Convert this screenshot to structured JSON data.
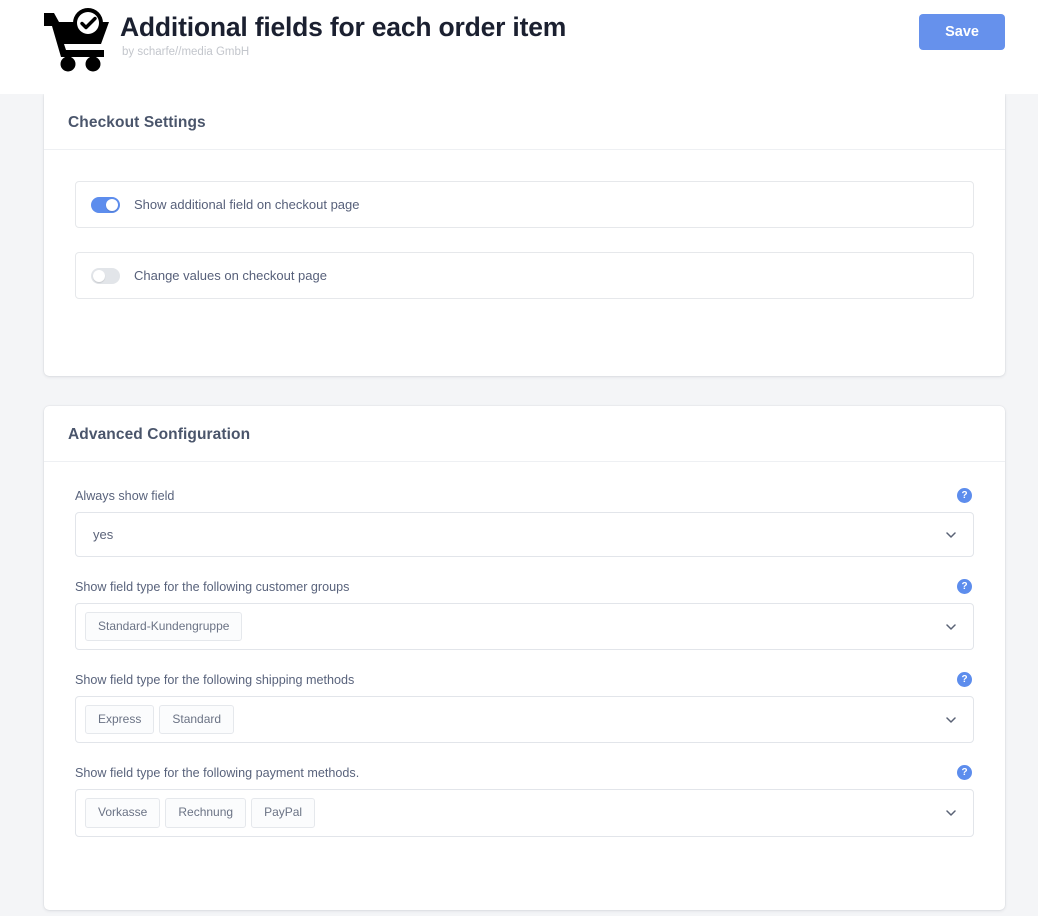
{
  "header": {
    "logo_icon": "shopping-cart-check-icon",
    "title": "Additional fields for each order item",
    "subtitle": "by scharfe//media GmbH",
    "save_label": "Save",
    "accent_color": "#6691ec"
  },
  "checkout_card": {
    "title": "Checkout Settings",
    "toggles": [
      {
        "label": "Show additional field on checkout page",
        "state": "on"
      },
      {
        "label": "Change values on checkout page",
        "state": "off"
      }
    ]
  },
  "advanced_card": {
    "title": "Advanced Configuration",
    "help_icon": "?",
    "fields": [
      {
        "label": "Always show field",
        "value": "yes",
        "tags": [],
        "chevron": "chevron-down-icon"
      },
      {
        "label": "Show field type for the following customer groups",
        "value": "",
        "tags": [
          "Standard-Kundengruppe"
        ],
        "chevron": "chevron-down-icon"
      },
      {
        "label": "Show field type for the following shipping methods",
        "value": "",
        "tags": [
          "Express",
          "Standard"
        ],
        "chevron": "chevron-down-icon"
      },
      {
        "label": "Show field type for the following payment methods.",
        "value": "",
        "tags": [
          "Vorkasse",
          "Rechnung",
          "PayPal"
        ],
        "chevron": "chevron-down-icon"
      }
    ]
  }
}
